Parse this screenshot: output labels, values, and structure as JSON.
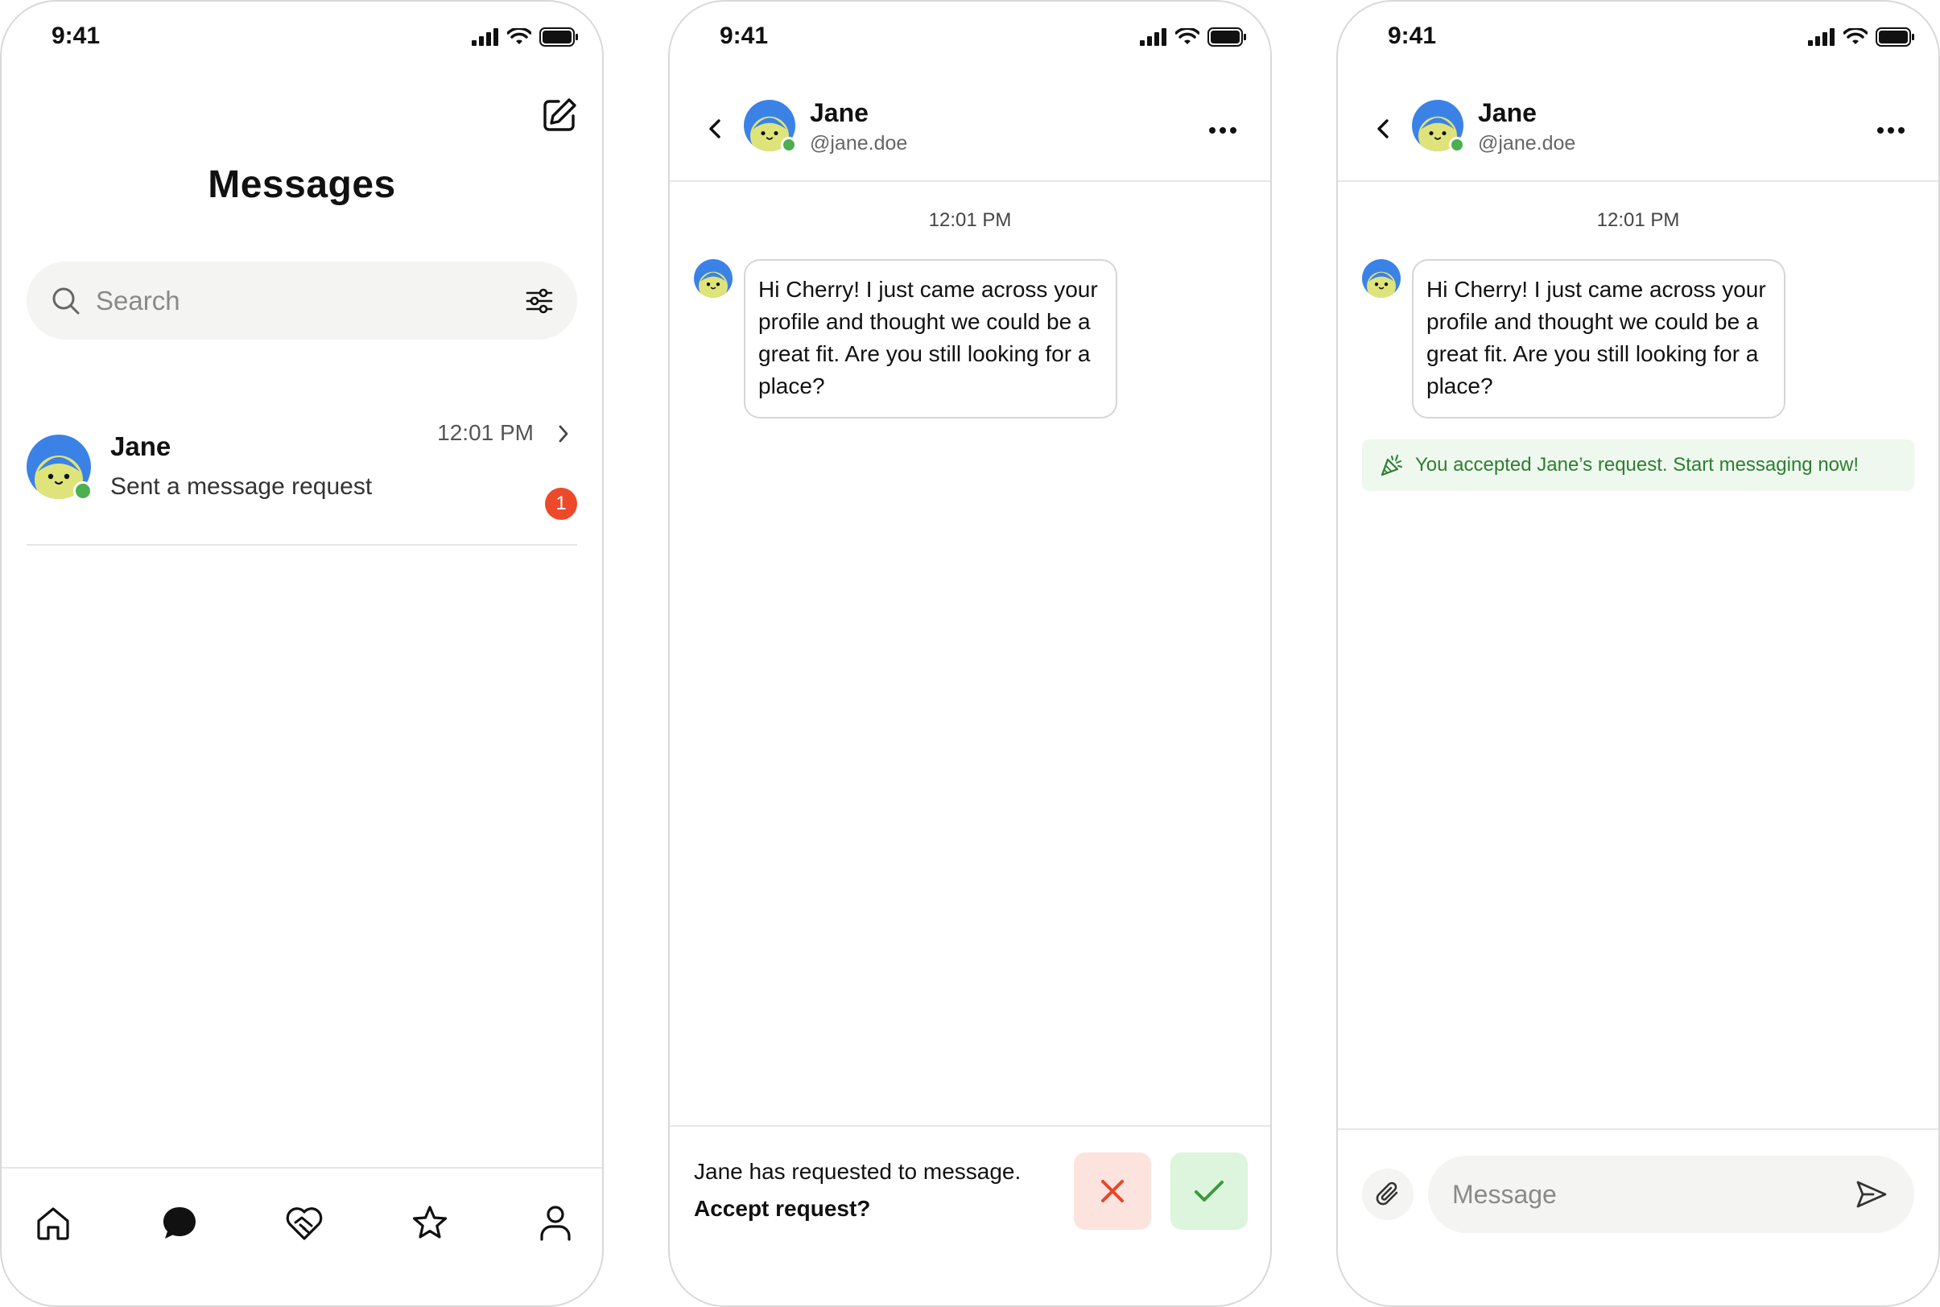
{
  "screens": [
    {
      "status_time": "9:41",
      "title": "Messages",
      "search": {
        "placeholder": "Search"
      },
      "conversation": {
        "name": "Jane",
        "preview": "Sent a message request",
        "time": "12:01 PM",
        "unread_count": "1"
      },
      "tabs": [
        "home-icon",
        "messages-icon",
        "heart-handshake-icon",
        "star-icon",
        "profile-icon"
      ]
    },
    {
      "status_time": "9:41",
      "header": {
        "name": "Jane",
        "handle": "@jane.doe"
      },
      "timestamp": "12:01 PM",
      "message": "Hi Cherry! I just came across your profile and thought we could be a great fit. Are you still looking for a place?",
      "request": {
        "text": "Jane has requested to message.",
        "question": "Accept request?"
      }
    },
    {
      "status_time": "9:41",
      "header": {
        "name": "Jane",
        "handle": "@jane.doe"
      },
      "timestamp": "12:01 PM",
      "message": "Hi Cherry! I just came across your profile and thought we could be a great fit. Are you still looking for a place?",
      "notice": "You accepted Jane’s request. Start messaging now!",
      "composer": {
        "placeholder": "Message"
      }
    }
  ],
  "colors": {
    "online": "#4caf50",
    "badge": "#ec4a2a",
    "decline_bg": "#fde3de",
    "decline_icon": "#e8462a",
    "accept_bg": "#dcf5dc",
    "accept_icon": "#3a9a3e",
    "notice_bg": "#eef8ee",
    "notice_text": "#2e7d32",
    "avatar_hair": "#3b82e6",
    "avatar_face": "#dfe47a"
  }
}
